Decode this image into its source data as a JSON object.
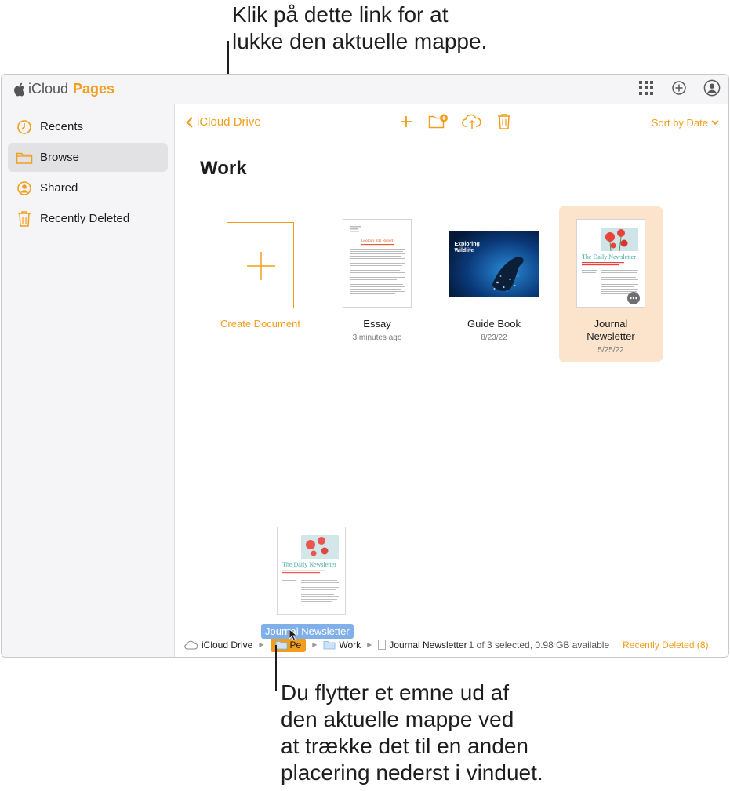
{
  "callouts": {
    "top": "Klik på dette link for at\nlukke den aktuelle mappe.",
    "bottom": "Du flytter et emne ud af\nden aktuelle mappe ved\nat trække det til en anden\nplacering nederst i vinduet."
  },
  "app": {
    "brand_icloud": "iCloud",
    "brand_pages": "Pages",
    "accent_color": "#f29d1c"
  },
  "top_icons": [
    "grid-apps-icon",
    "add-circle-icon",
    "account-icon"
  ],
  "sidebar": {
    "items": [
      {
        "label": "Recents",
        "icon": "clock-icon",
        "active": false
      },
      {
        "label": "Browse",
        "icon": "folder-icon",
        "active": true
      },
      {
        "label": "Shared",
        "icon": "person-circle-icon",
        "active": false
      },
      {
        "label": "Recently Deleted",
        "icon": "trash-icon",
        "active": false
      }
    ]
  },
  "main": {
    "back_label": "iCloud Drive",
    "sort_label": "Sort by Date",
    "folder_title": "Work",
    "toolbar_icons": [
      "plus-icon",
      "new-folder-icon",
      "upload-icon",
      "trash-icon"
    ]
  },
  "documents": [
    {
      "name": "Create Document",
      "meta": "",
      "type": "create"
    },
    {
      "name": "Essay",
      "meta": "3 minutes ago",
      "type": "essay"
    },
    {
      "name": "Guide Book",
      "meta": "8/23/22",
      "type": "guide"
    },
    {
      "name": "Journal\nNewsletter",
      "meta": "5/25/22",
      "type": "journal",
      "selected": true
    }
  ],
  "thumb_text": {
    "essay_title": "Geology 101 Report",
    "guide_title_line1": "Exploring",
    "guide_title_line2": "Wildlife",
    "journal_title": "The Daily Newsletter"
  },
  "drag": {
    "label": "Journal Newsletter"
  },
  "pathbar": {
    "crumbs": [
      "iCloud Drive",
      "Pe",
      "Work",
      "Journal Newsletter"
    ],
    "status": "1 of 3 selected, 0.98 GB available",
    "recently_deleted": "Recently Deleted (8)"
  }
}
